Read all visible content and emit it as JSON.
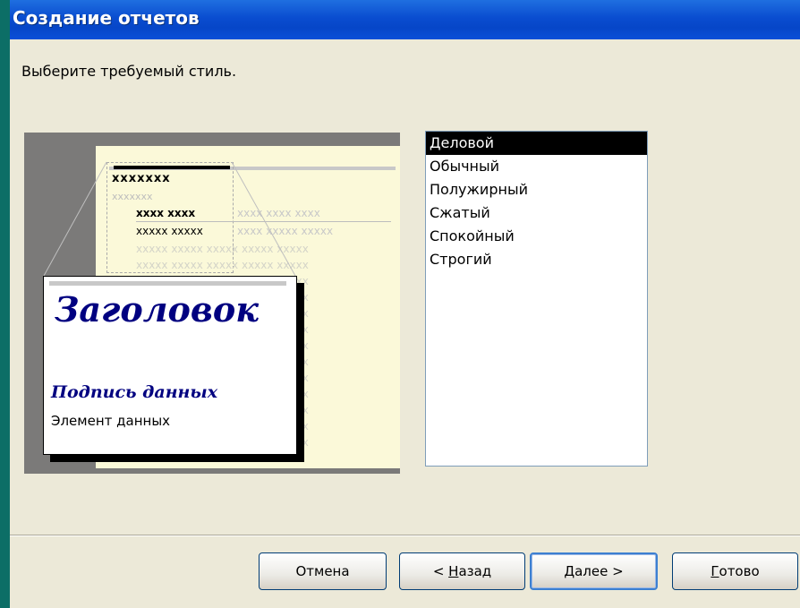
{
  "window": {
    "title": "Создание отчетов"
  },
  "prompt": "Выберите требуемый стиль.",
  "preview": {
    "group_placeholder": "xxxxxxx",
    "subgroup_placeholder": "xxxxxxx",
    "column_headers": "xxxx xxxx",
    "column_headers_faded": "xxxx xxxx xxxx",
    "data_row": "xxxxx xxxxx",
    "data_row_faded": "xxxx xxxxx xxxxx",
    "faded_row": "xxxxx xxxxx xxxxx xxxxx xxxxx",
    "heading": "Заголовок",
    "data_label": "Подпись данных",
    "data_item": "Элемент данных"
  },
  "styles": {
    "selected": "Деловой",
    "options": [
      "Деловой",
      "Обычный",
      "Полужирный",
      "Сжатый",
      "Спокойный",
      "Строгий"
    ]
  },
  "buttons": {
    "cancel": "Отмена",
    "back_prefix": "< ",
    "back_mnemonic": "Н",
    "back_rest": "азад",
    "next_mnemonic": "Д",
    "next_rest": "алее >",
    "finish_mnemonic": "Г",
    "finish_rest": "отово"
  }
}
